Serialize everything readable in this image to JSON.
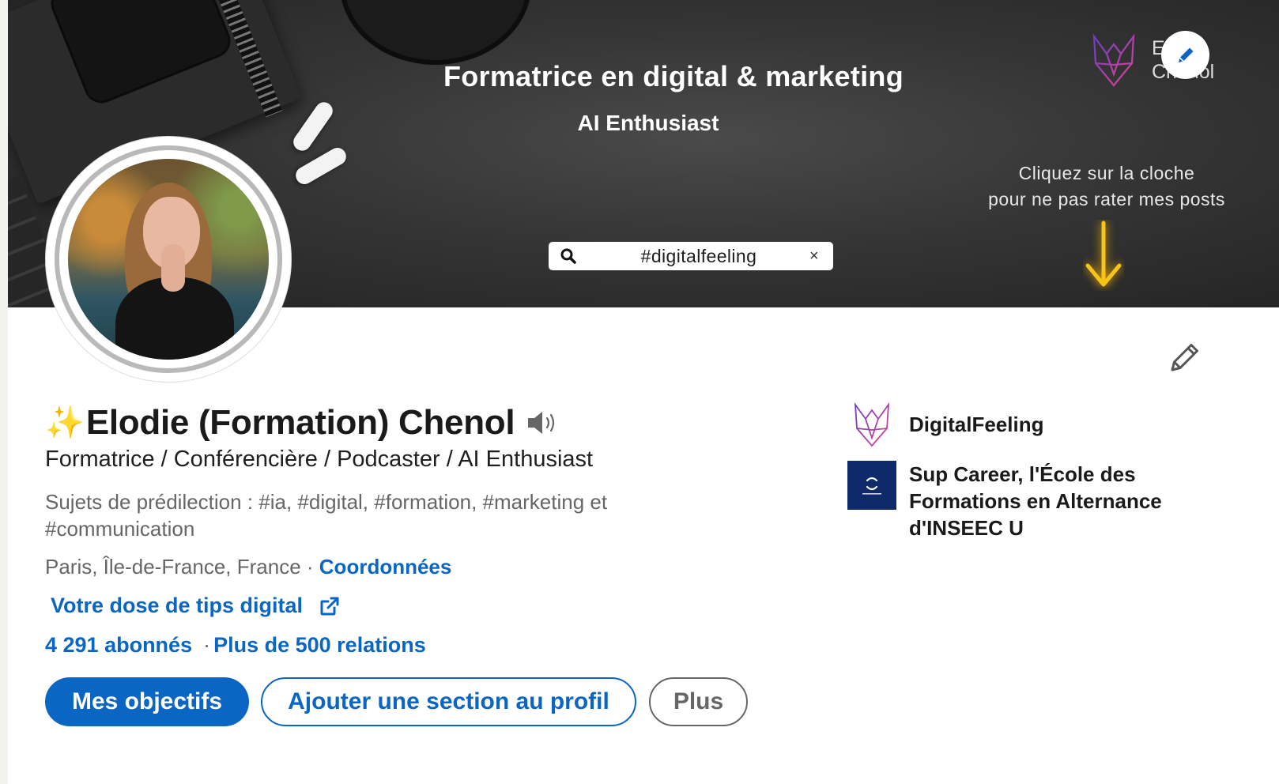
{
  "banner": {
    "title": "Formatrice en digital & marketing",
    "subtitle": "AI Enthusiast",
    "cta_line1": "Cliquez sur la cloche",
    "cta_line2": "pour ne pas rater mes posts",
    "search_tag": "#digitalfeeling",
    "search_clear": "×",
    "brand_word_line1": "E",
    "brand_word_line2": "Chenol"
  },
  "profile": {
    "sparkle": "✨",
    "name": "Elodie (Formation) Chenol",
    "headline": "Formatrice / Conférencière / Podcaster / AI Enthusiast",
    "topics": "Sujets de prédilection : #ia, #digital, #formation, #marketing et #communication",
    "location": "Paris, Île-de-France, France",
    "location_sep": " · ",
    "contact_link": "Coordonnées",
    "website": "Votre dose de tips digital",
    "followers": "4 291 abonnés",
    "stats_sep": "·",
    "connections": "Plus de 500 relations"
  },
  "actions": {
    "primary": "Mes objectifs",
    "secondary": "Ajouter une section au profil",
    "tertiary": "Plus"
  },
  "companies": [
    {
      "name": "DigitalFeeling"
    },
    {
      "name": "Sup Career, l'École des Formations en Alternance d'INSEEC U"
    }
  ],
  "colors": {
    "accent": "#0a66c2",
    "text": "#1a1a1a",
    "muted": "#666666",
    "banner_bg": "#353535",
    "arrow": "#f5c518"
  },
  "icons": {
    "banner_edit": "pencil-icon",
    "profile_edit": "pencil-outline-icon",
    "pronunciation": "speaker-icon",
    "website_external": "external-link-icon",
    "search": "search-icon"
  }
}
